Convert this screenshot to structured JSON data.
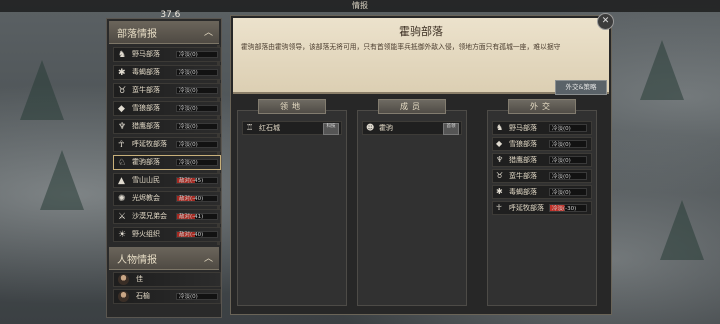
{
  "topbar": {
    "title": "情报"
  },
  "weather": {
    "temperature": "37.6",
    "unit": "℃"
  },
  "tribe_section": {
    "header": "部落情报",
    "items": [
      {
        "icon": "horse-icon",
        "glyph": "♞",
        "name": "野马部落",
        "status": "冷淡(0)"
      },
      {
        "icon": "spider-icon",
        "glyph": "✱",
        "name": "毒蝎部落",
        "status": "冷淡(0)"
      },
      {
        "icon": "bull-icon",
        "glyph": "♉",
        "name": "蛮牛部落",
        "status": "冷淡(0)"
      },
      {
        "icon": "wolf-icon",
        "glyph": "◆",
        "name": "雪狼部落",
        "status": "冷淡(0)"
      },
      {
        "icon": "eagle-icon",
        "glyph": "♆",
        "name": "猎鹰部落",
        "status": "冷淡(0)"
      },
      {
        "icon": "totem-icon",
        "glyph": "☥",
        "name": "呼延牧部落",
        "status": "冷淡(0)"
      },
      {
        "icon": "dog-icon",
        "glyph": "♘",
        "name": "霍驹部落",
        "status": "冷淡(0)",
        "selected": true
      },
      {
        "icon": "mountain-icon",
        "glyph": "▲",
        "name": "雪山山民",
        "status": "敌对(-45)",
        "hostile": true
      },
      {
        "icon": "flame-icon",
        "glyph": "✺",
        "name": "光烬教会",
        "status": "敌对(-40)",
        "hostile": true
      },
      {
        "icon": "crossed-swords-icon",
        "glyph": "⚔",
        "name": "沙漠兄弟会",
        "status": "敌对(-41)",
        "hostile": true
      },
      {
        "icon": "fire-icon",
        "glyph": "☀",
        "name": "野火组织",
        "status": "敌对(-40)",
        "hostile": true
      }
    ]
  },
  "people_section": {
    "header": "人物情报",
    "items": [
      {
        "name": "佳",
        "status": ""
      },
      {
        "name": "石榆",
        "status": "冷淡(0)"
      }
    ]
  },
  "main": {
    "title": "霍驹部落",
    "description": "霍驹部落由霍驹领导，该部落无将可用，只有首领能率兵抵御外敌入侵，领地方面只有孤城一座，难以据守",
    "diplomacy_button": "外交&策略"
  },
  "territory": {
    "header": "领地",
    "items": [
      {
        "name": "红石城",
        "tag": "科技"
      }
    ]
  },
  "members": {
    "header": "成员",
    "items": [
      {
        "name": "霍驹",
        "tag": "首领"
      }
    ]
  },
  "diplomacy": {
    "header": "外交",
    "items": [
      {
        "icon": "horse-icon",
        "glyph": "♞",
        "name": "野马部落",
        "status": "冷淡(0)"
      },
      {
        "icon": "wolf-icon",
        "glyph": "◆",
        "name": "雪狼部落",
        "status": "冷淡(0)"
      },
      {
        "icon": "eagle-icon",
        "glyph": "♆",
        "name": "猎鹰部落",
        "status": "冷淡(0)"
      },
      {
        "icon": "bull-icon",
        "glyph": "♉",
        "name": "蛮牛部落",
        "status": "冷淡(0)"
      },
      {
        "icon": "spider-icon",
        "glyph": "✱",
        "name": "毒蝎部落",
        "status": "冷淡(0)"
      },
      {
        "icon": "totem-icon",
        "glyph": "☥",
        "name": "呼延牧部落",
        "status": "冷淡(-30)",
        "hostile": true
      }
    ]
  }
}
